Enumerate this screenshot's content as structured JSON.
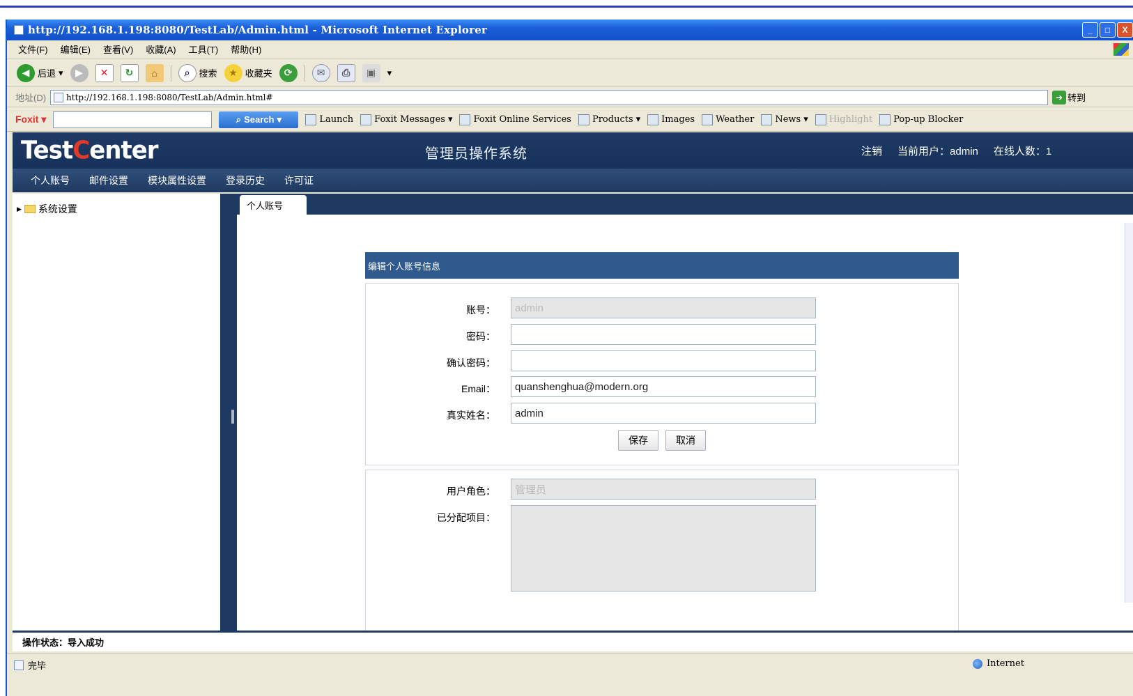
{
  "browser": {
    "title": "http://192.168.1.198:8080/TestLab/Admin.html - Microsoft Internet Explorer",
    "window_buttons": {
      "min": "_",
      "max": "□",
      "close": "X"
    },
    "menu": [
      "文件(F)",
      "编辑(E)",
      "查看(V)",
      "收藏(A)",
      "工具(T)",
      "帮助(H)"
    ],
    "toolbar": {
      "back": "后退",
      "search": "搜索",
      "favorites": "收藏夹"
    },
    "address_label": "地址(D)",
    "address": "http://192.168.1.198:8080/TestLab/Admin.html#",
    "go_label": "转到",
    "foxit": {
      "logo": "Foxit",
      "search_button": "Search",
      "items": [
        "Launch",
        "Foxit Messages",
        "Foxit Online Services",
        "Products",
        "Images",
        "Weather",
        "News",
        "Highlight",
        "Pop-up Blocker"
      ]
    },
    "status_left": "完毕",
    "status_zone": "Internet"
  },
  "app": {
    "logo_pre": "Test",
    "logo_c": "C",
    "logo_post": "enter",
    "title": "管理员操作系统",
    "logout": "注销",
    "current_user": "当前用户：admin",
    "online": "在线人数：1",
    "nav": [
      "个人账号",
      "邮件设置",
      "模块属性设置",
      "登录历史",
      "许可证"
    ],
    "sidebar_item": "系统设置",
    "tab": "个人账号",
    "form_title": "编辑个人账号信息",
    "fields": {
      "account": {
        "label": "账号：",
        "value": "admin"
      },
      "password": {
        "label": "密码：",
        "value": ""
      },
      "confirm": {
        "label": "确认密码：",
        "value": ""
      },
      "email": {
        "label": "Email：",
        "value": "quanshenghua@modern.org"
      },
      "realname": {
        "label": "真实姓名：",
        "value": "admin"
      }
    },
    "save": "保存",
    "cancel": "取消",
    "role": {
      "label": "用户角色：",
      "value": "管理员"
    },
    "projects": {
      "label": "已分配项目：",
      "value": ""
    },
    "op_status": "操作状态：导入成功"
  }
}
